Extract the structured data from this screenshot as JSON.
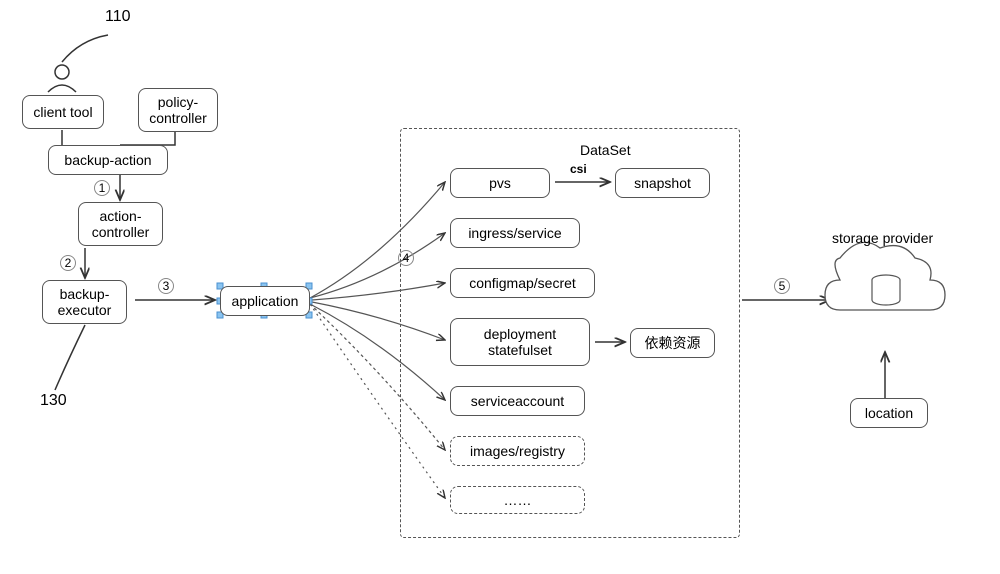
{
  "callouts": {
    "c110": "110",
    "c130": "130"
  },
  "boxes": {
    "client_tool": "client tool",
    "policy_controller": "policy-\ncontroller",
    "backup_action": "backup-action",
    "action_controller": "action-\ncontroller",
    "backup_executor": "backup-\nexecutor",
    "application": "application",
    "pvs": "pvs",
    "snapshot": "snapshot",
    "ingress_service": "ingress/service",
    "configmap_secret": "configmap/secret",
    "deployment_statefulset": "deployment\nstatefulset",
    "dependency": "依赖资源",
    "serviceaccount": "serviceaccount",
    "images_registry": "images/registry",
    "ellipsis": "……",
    "location": "location"
  },
  "labels": {
    "dataset_title": "DataSet",
    "csi": "csi",
    "storage_provider": "storage provider"
  },
  "steps": {
    "s1": "1",
    "s2": "2",
    "s3": "3",
    "s4": "4",
    "s5": "5"
  }
}
